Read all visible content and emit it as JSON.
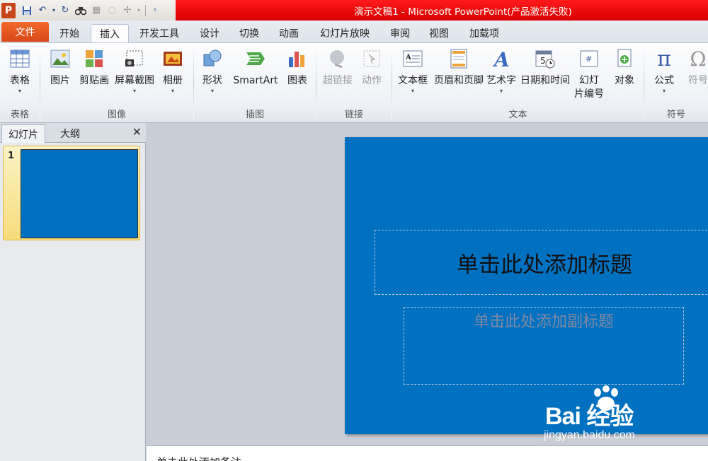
{
  "title_bar": {
    "title": "演示文稿1 - Microsoft PowerPoint(产品激活失败)",
    "logo": "P"
  },
  "quick_access": {
    "icons": [
      "save-icon",
      "undo-icon",
      "redo-icon",
      "find-icon",
      "clipboard-icon",
      "clear-icon",
      "draw-table-icon",
      "customize-icon"
    ]
  },
  "tabs": {
    "file": "文件",
    "home": "开始",
    "insert": "插入",
    "developer": "开发工具",
    "design": "设计",
    "transitions": "切换",
    "animations": "动画",
    "slideshow": "幻灯片放映",
    "review": "审阅",
    "view": "视图",
    "addins": "加载项"
  },
  "ribbon": {
    "table_btn": "表格",
    "table_group": "表格",
    "picture_btn": "图片",
    "clipart_btn": "剪贴画",
    "screenshot_btn": "屏幕截图",
    "album_btn": "相册",
    "images_group": "图像",
    "shapes_btn": "形状",
    "smartart_btn": "SmartArt",
    "chart_btn": "图表",
    "illustrations_group": "插图",
    "hyperlink_btn": "超链接",
    "action_btn": "动作",
    "links_group": "链接",
    "textbox_btn": "文本框",
    "headerfooter_btn": "页眉和页脚",
    "wordart_btn": "艺术字",
    "datetime_btn": "日期和时间",
    "slidenum_btn_line1": "幻灯",
    "slidenum_btn_line2": "片编号",
    "object_btn": "对象",
    "text_group": "文本",
    "equation_btn": "公式",
    "symbol_btn": "符号",
    "symbols_group": "符号"
  },
  "left_pane": {
    "tab_slides": "幻灯片",
    "tab_outline": "大纲",
    "close": "✕",
    "thumb_number": "1"
  },
  "slide": {
    "title_placeholder": "单击此处添加标题",
    "subtitle_placeholder": "单击此处添加副标题",
    "background_color": "#0070c0"
  },
  "notes": {
    "placeholder": "单击此处添加备注"
  },
  "watermark": {
    "text": "Bai 经验",
    "url": "jingyan.baidu.com"
  }
}
